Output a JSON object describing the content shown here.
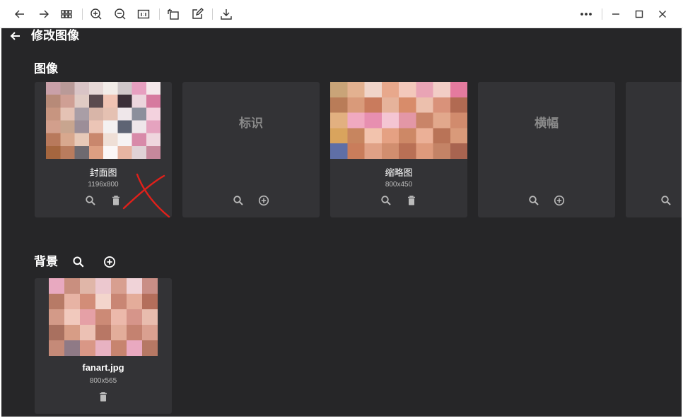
{
  "titlebar": {
    "icons": [
      "back-icon",
      "forward-icon",
      "grid-icon",
      "zoom-in-icon",
      "zoom-out-icon",
      "actual-size-icon",
      "rotate-icon",
      "edit-icon",
      "download-icon",
      "more-icon",
      "minimize-icon",
      "maximize-icon",
      "close-icon"
    ]
  },
  "header": {
    "title": "修改图像"
  },
  "images_section": {
    "title": "图像",
    "cards": [
      {
        "kind": "image",
        "label": "封面图",
        "dims": "1196x800",
        "actions": [
          "search-icon",
          "delete-icon"
        ]
      },
      {
        "kind": "empty",
        "label": "标识",
        "actions": [
          "search-icon",
          "add-icon"
        ]
      },
      {
        "kind": "image",
        "label": "缩略图",
        "dims": "800x450",
        "actions": [
          "search-icon",
          "delete-icon"
        ]
      },
      {
        "kind": "empty",
        "label": "横幅",
        "actions": [
          "search-icon",
          "add-icon"
        ]
      }
    ]
  },
  "background_section": {
    "title": "背景",
    "cards": [
      {
        "kind": "image",
        "label": "fanart.jpg",
        "dims": "800x565",
        "actions": [
          "delete-icon"
        ]
      }
    ]
  },
  "colors": {
    "app_bg": "#262628",
    "card_bg": "#333336",
    "annotation": "#e0201a"
  }
}
